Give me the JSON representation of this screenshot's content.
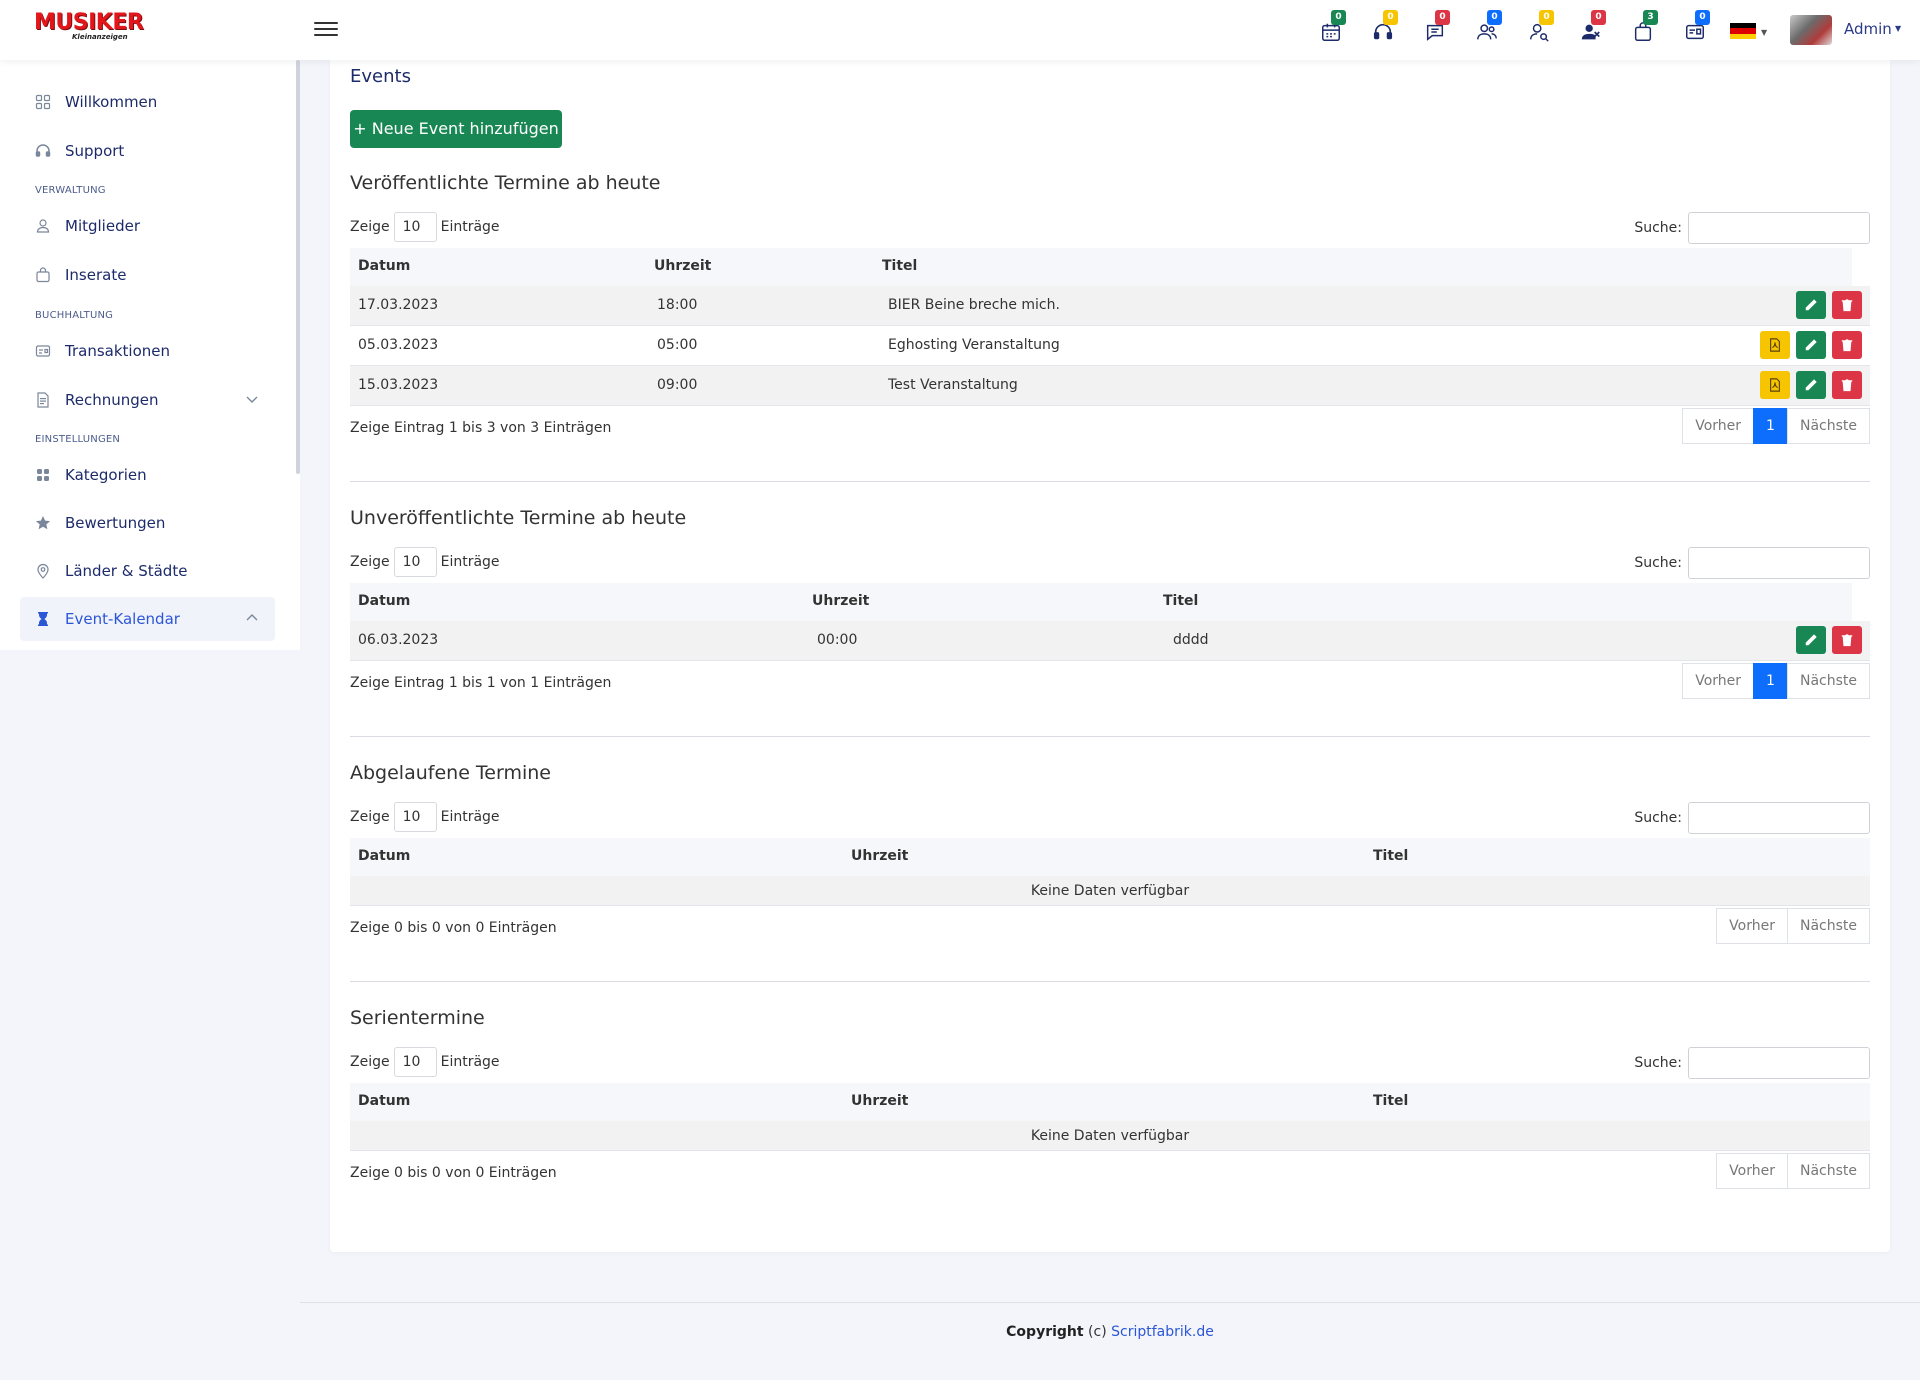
{
  "brand": {
    "name": "MUSIKER",
    "tagline": "Kleinanzeigen"
  },
  "header": {
    "icons": [
      {
        "name": "calendar-icon",
        "badge": "0",
        "color": "#198754"
      },
      {
        "name": "headset-icon",
        "badge": "0",
        "color": "#f7c400"
      },
      {
        "name": "chat-icon",
        "badge": "0",
        "color": "#dc3545"
      },
      {
        "name": "users-icon",
        "badge": "0",
        "color": "#0d6efd"
      },
      {
        "name": "user-search-icon",
        "badge": "0",
        "color": "#f7c400"
      },
      {
        "name": "user-x-icon",
        "badge": "0",
        "color": "#dc3545"
      },
      {
        "name": "bag-icon",
        "badge": "3",
        "color": "#198754"
      },
      {
        "name": "id-card-icon",
        "badge": "0",
        "color": "#0d6efd"
      }
    ],
    "language": "de",
    "user": "Admin"
  },
  "sidebar": {
    "items": [
      {
        "label": "Willkommen",
        "icon": "grid-icon"
      },
      {
        "label": "Support",
        "icon": "headset-icon"
      },
      {
        "label": "Mitglieder",
        "icon": "user-icon"
      },
      {
        "label": "Inserate",
        "icon": "bag-icon"
      },
      {
        "label": "Transaktionen",
        "icon": "card-icon"
      },
      {
        "label": "Rechnungen",
        "icon": "document-icon"
      },
      {
        "label": "Kategorien",
        "icon": "apps-icon"
      },
      {
        "label": "Bewertungen",
        "icon": "star-icon"
      },
      {
        "label": "Länder & Städte",
        "icon": "map-pin-icon"
      },
      {
        "label": "Event-Kalendar",
        "icon": "hourglass-icon"
      }
    ],
    "sections": [
      "VERWALTUNG",
      "BUCHHALTUNG",
      "EINSTELLUNGEN"
    ]
  },
  "main": {
    "title": "Events",
    "add_button": "+ Neue Event hinzufügen",
    "labels": {
      "show": "Zeige",
      "entries": "Einträge",
      "search": "Suche:",
      "prev": "Vorher",
      "next": "Nächste",
      "col_date": "Datum",
      "col_time": "Uhrzeit",
      "col_title": "Titel",
      "no_data": "Keine Daten verfügbar"
    },
    "sections": [
      {
        "title": "Veröffentlichte Termine ab heute",
        "page_length": "10",
        "rows": [
          {
            "date": "17.03.2023",
            "time": "18:00",
            "title": "BIER Beine breche mich."
          },
          {
            "date": "05.03.2023",
            "time": "05:00",
            "title": "Eghosting Veranstaltung"
          },
          {
            "date": "15.03.2023",
            "time": "09:00",
            "title": "Test Veranstaltung"
          }
        ],
        "info": "Zeige Eintrag 1 bis 3 von 3 Einträgen",
        "page": "1"
      },
      {
        "title": "Unveröffentlichte Termine ab heute",
        "page_length": "10",
        "rows": [
          {
            "date": "06.03.2023",
            "time": "00:00",
            "title": "dddd"
          }
        ],
        "info": "Zeige Eintrag 1 bis 1 von 1 Einträgen",
        "page": "1"
      },
      {
        "title": "Abgelaufene Termine",
        "page_length": "10",
        "rows": [],
        "info": "Zeige 0 bis 0 von 0 Einträgen"
      },
      {
        "title": "Serientermine",
        "page_length": "10",
        "rows": [],
        "info": "Zeige 0 bis 0 von 0 Einträgen"
      }
    ]
  },
  "footer": {
    "copyright": "Copyright",
    "c": "(c)",
    "company": "Scriptfabrik.de"
  }
}
